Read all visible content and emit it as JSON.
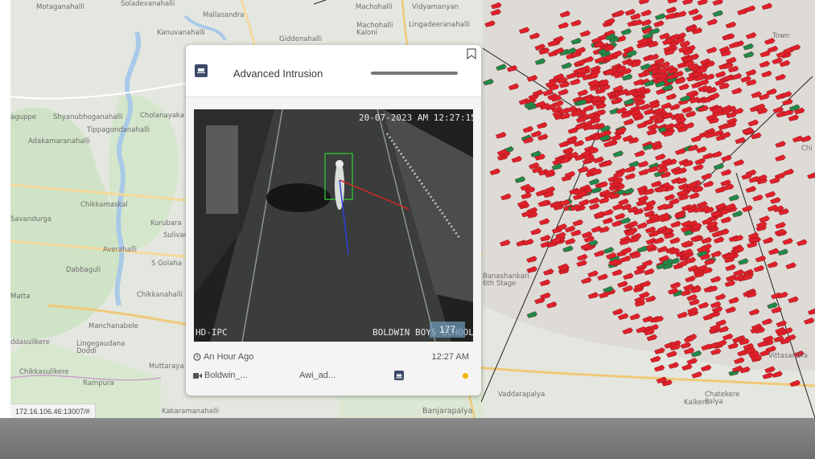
{
  "map": {
    "places": [
      {
        "name": "Motaganahalli"
      },
      {
        "name": "Soladevanahalli"
      },
      {
        "name": "Mallasandra"
      },
      {
        "name": "Machohalli"
      },
      {
        "name": "Vidyamanyan"
      },
      {
        "name": "Kanuvanahalli"
      },
      {
        "name": "Giddenahalli"
      },
      {
        "name": "Machohalli Kaloni"
      },
      {
        "name": "Lingadeeranahalli"
      },
      {
        "name": "aguppe"
      },
      {
        "name": "Shyanubhoganahalli"
      },
      {
        "name": "Cholanayaka"
      },
      {
        "name": "Tippagondanahalli"
      },
      {
        "name": "Adakamaranahalli"
      },
      {
        "name": "Chikkamaskal"
      },
      {
        "name": "Kurubara"
      },
      {
        "name": "Sulivar"
      },
      {
        "name": "Savandurga"
      },
      {
        "name": "Averahalli"
      },
      {
        "name": "Dabbaguli"
      },
      {
        "name": "S Golaha"
      },
      {
        "name": "Chikkanahalli"
      },
      {
        "name": "Manchanabele"
      },
      {
        "name": "Lingegaudana Doddi"
      },
      {
        "name": "ddasulikere"
      },
      {
        "name": "Muttaraya"
      },
      {
        "name": "Chikkasulikere"
      },
      {
        "name": "Rampura"
      },
      {
        "name": "Kakaramanahalli"
      },
      {
        "name": "Banjarapalya"
      },
      {
        "name": "Vaddarapalya"
      },
      {
        "name": "Kalkere"
      },
      {
        "name": "Chatekere Palya"
      },
      {
        "name": "Vittasandra"
      },
      {
        "name": "Banashankari 6th Stage"
      },
      {
        "name": "Matta"
      },
      {
        "name": "Town"
      },
      {
        "name": "Chi"
      }
    ],
    "marker_colors": {
      "alert": "#e0202a",
      "normal": "#1e8a4a"
    }
  },
  "status_url": "172.16.106.46:13007/#",
  "card": {
    "title": "Advanced Intrusion",
    "header_icon": "camera-event-icon",
    "bookmark_icon": "bookmark-icon",
    "video": {
      "timestamp": "20-07-2023 AM 12:27:15",
      "camera_type": "HD-IPC",
      "location_overlay": "BOLDWIN BOYS SCHOOL-G",
      "badge": "177"
    },
    "time_ago": "An Hour Ago",
    "time": "12:27 AM",
    "camera_name": "Boldwin_...",
    "analytic_name": "Awi_ad...",
    "status_color": "#f2b400"
  }
}
